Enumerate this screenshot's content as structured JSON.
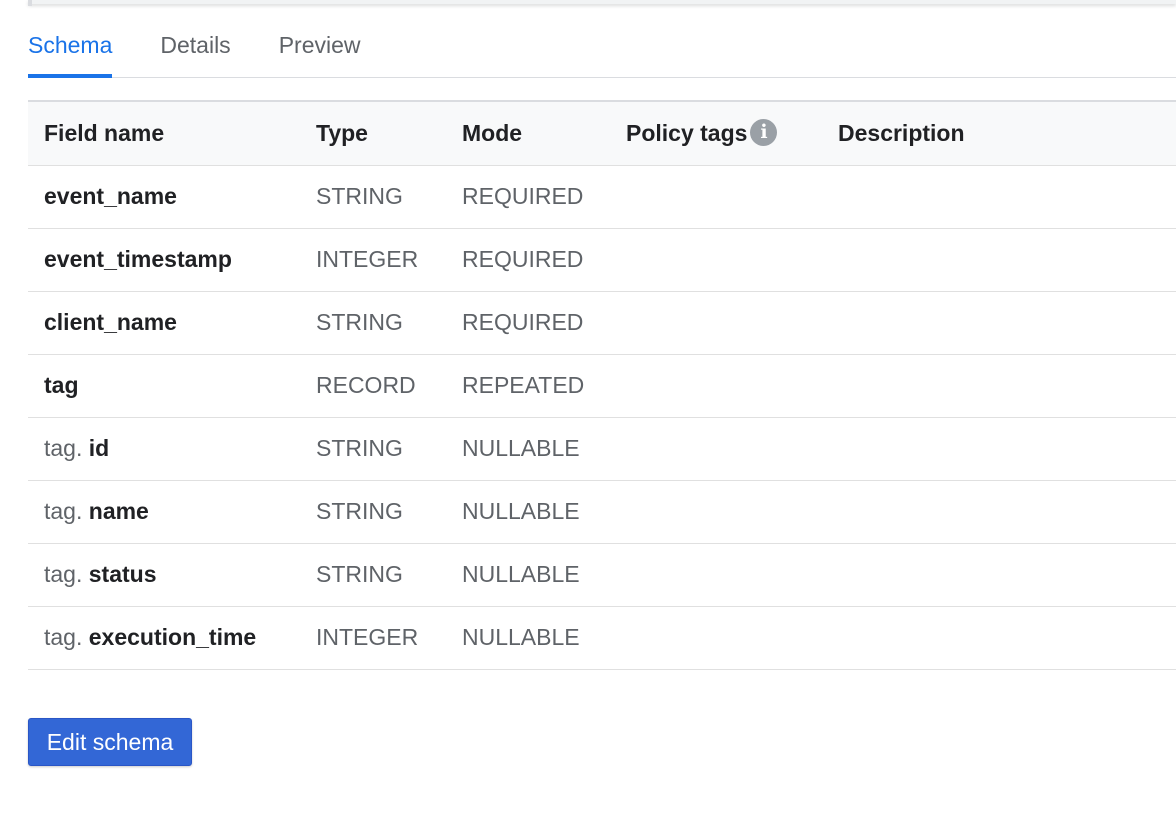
{
  "tabs": [
    {
      "label": "Schema",
      "active": true
    },
    {
      "label": "Details",
      "active": false
    },
    {
      "label": "Preview",
      "active": false
    }
  ],
  "table": {
    "headers": {
      "field_name": "Field name",
      "type": "Type",
      "mode": "Mode",
      "policy_tags": "Policy tags",
      "description": "Description"
    },
    "rows": [
      {
        "prefix": "",
        "name": "event_name",
        "type": "STRING",
        "mode": "REQUIRED",
        "policy_tags": "",
        "description": ""
      },
      {
        "prefix": "",
        "name": "event_timestamp",
        "type": "INTEGER",
        "mode": "REQUIRED",
        "policy_tags": "",
        "description": ""
      },
      {
        "prefix": "",
        "name": "client_name",
        "type": "STRING",
        "mode": "REQUIRED",
        "policy_tags": "",
        "description": ""
      },
      {
        "prefix": "",
        "name": "tag",
        "type": "RECORD",
        "mode": "REPEATED",
        "policy_tags": "",
        "description": ""
      },
      {
        "prefix": "tag. ",
        "name": "id",
        "type": "STRING",
        "mode": "NULLABLE",
        "policy_tags": "",
        "description": ""
      },
      {
        "prefix": "tag. ",
        "name": "name",
        "type": "STRING",
        "mode": "NULLABLE",
        "policy_tags": "",
        "description": ""
      },
      {
        "prefix": "tag. ",
        "name": "status",
        "type": "STRING",
        "mode": "NULLABLE",
        "policy_tags": "",
        "description": ""
      },
      {
        "prefix": "tag. ",
        "name": "execution_time",
        "type": "INTEGER",
        "mode": "NULLABLE",
        "policy_tags": "",
        "description": ""
      }
    ]
  },
  "icons": {
    "policy_info": "info-icon",
    "policy_info_glyph": "i"
  },
  "actions": {
    "edit_schema_label": "Edit schema"
  },
  "colors": {
    "accent": "#1a73e8",
    "button": "#3367d6"
  }
}
